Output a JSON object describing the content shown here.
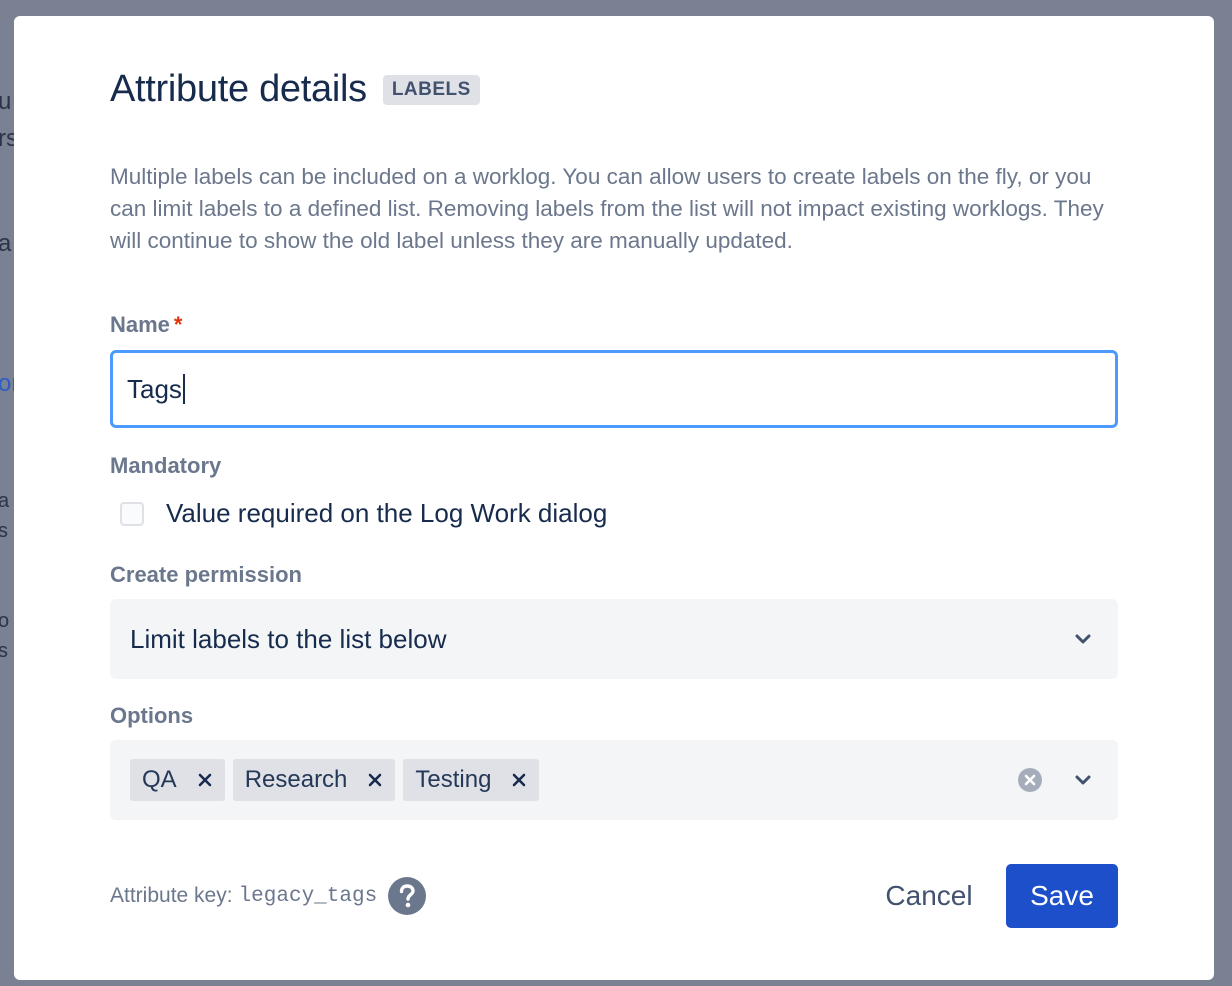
{
  "colors": {
    "accent": "#1d4fca",
    "focus_border": "#4c9aff",
    "required": "#de350b",
    "overlay": "#7a8193"
  },
  "dialog": {
    "title": "Attribute details",
    "badge": "LABELS",
    "description": "Multiple labels can be included on a worklog. You can allow users to create labels on the fly, or you can limit labels to a defined list. Removing labels from the list will not impact existing worklogs. They will continue to show the old label unless they are manually updated."
  },
  "name_field": {
    "label": "Name",
    "required_marker": "*",
    "value": "Tags"
  },
  "mandatory": {
    "label": "Mandatory",
    "checkbox_label": "Value required on the Log Work dialog",
    "checked": false
  },
  "create_permission": {
    "label": "Create permission",
    "selected": "Limit labels to the list below",
    "icon": "chevron-down-icon"
  },
  "options": {
    "label": "Options",
    "values": [
      "QA",
      "Research",
      "Testing"
    ],
    "remove_icon": "close-icon",
    "clear_icon": "clear-icon"
  },
  "footer": {
    "key_label": "Attribute key:",
    "key_value": "legacy_tags",
    "help_icon": "question-icon",
    "cancel_label": "Cancel",
    "save_label": "Save"
  }
}
